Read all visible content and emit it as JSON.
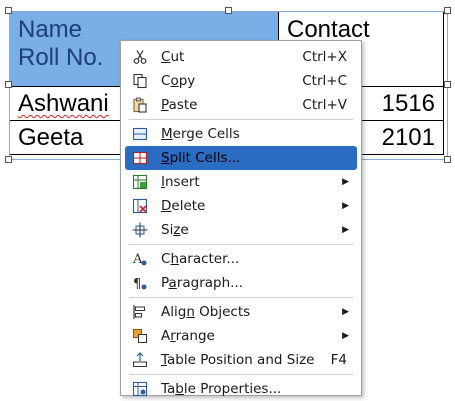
{
  "table": {
    "rows": [
      [
        {
          "text_line1": "Name",
          "text_line2": "Roll No."
        },
        {
          "text_line1": "Contact",
          "text_line2": ""
        }
      ],
      [
        {
          "text": "Ashwani"
        },
        {
          "text": "1516"
        }
      ],
      [
        {
          "text": "Geeta"
        },
        {
          "text": "2101"
        }
      ]
    ]
  },
  "menu": {
    "items": [
      {
        "id": "cut",
        "pre": "",
        "u": "C",
        "post": "ut",
        "shortcut": "Ctrl+X",
        "icon": "scissors-icon"
      },
      {
        "id": "copy",
        "pre": "C",
        "u": "o",
        "post": "py",
        "shortcut": "Ctrl+C",
        "icon": "copy-icon"
      },
      {
        "id": "paste",
        "pre": "",
        "u": "P",
        "post": "aste",
        "shortcut": "Ctrl+V",
        "icon": "paste-icon"
      },
      {
        "id": "merge-cells",
        "pre": "",
        "u": "M",
        "post": "erge Cells",
        "icon": "merge-cells-icon"
      },
      {
        "id": "split-cells",
        "pre": "",
        "u": "S",
        "post": "plit Cells...",
        "icon": "split-cells-icon",
        "highlighted": true
      },
      {
        "id": "insert",
        "pre": "",
        "u": "I",
        "post": "nsert",
        "icon": "insert-rows-icon",
        "submenu": true
      },
      {
        "id": "delete",
        "pre": "",
        "u": "D",
        "post": "elete",
        "icon": "delete-table-icon",
        "submenu": true
      },
      {
        "id": "size",
        "pre": "Si",
        "u": "z",
        "post": "e",
        "icon": "size-icon",
        "submenu": true
      },
      {
        "id": "character",
        "pre": "C",
        "u": "h",
        "post": "aracter...",
        "icon": "character-icon"
      },
      {
        "id": "paragraph",
        "pre": "P",
        "u": "a",
        "post": "ragraph...",
        "icon": "paragraph-icon"
      },
      {
        "id": "align-objects",
        "pre": "Alig",
        "u": "n",
        "post": " Objects",
        "icon": "align-objects-icon",
        "submenu": true
      },
      {
        "id": "arrange",
        "pre": "A",
        "u": "r",
        "post": "range",
        "icon": "arrange-icon",
        "submenu": true
      },
      {
        "id": "table-position-size",
        "pre": "",
        "u": "T",
        "post": "able Position and Size",
        "shortcut": "F4",
        "icon": "table-position-icon"
      },
      {
        "id": "table-properties",
        "pre": "Ta",
        "u": "b",
        "post": "le Properties...",
        "icon": "table-properties-icon"
      }
    ],
    "submenu_arrow": "▶"
  },
  "colors": {
    "selected_cell": "#79aee6",
    "selected_text": "#1c3f7a",
    "menu_highlight": "#2a6cc2"
  }
}
